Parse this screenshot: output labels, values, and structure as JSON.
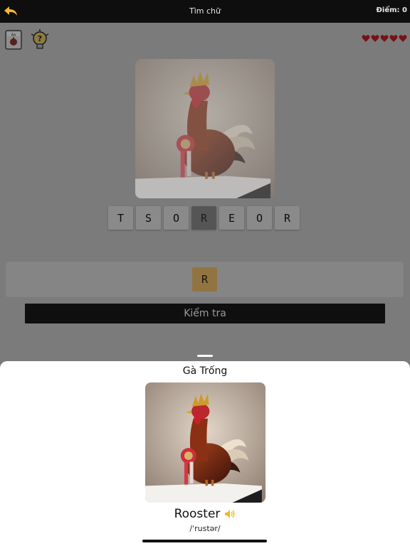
{
  "header": {
    "title": "Tìm chữ",
    "score_label": "Điểm: 0",
    "back_icon": "back-arrow-icon"
  },
  "toolbar": {
    "book_icon": "flashcard-book-icon",
    "book_badge": "Aa",
    "hint_icon": "hint-lightbulb-icon"
  },
  "lives": {
    "count": 5,
    "icon": "heart-icon",
    "color": "#e0202a"
  },
  "puzzle": {
    "image": "rooster-photo",
    "tiles": [
      {
        "letter": "T",
        "used": false
      },
      {
        "letter": "S",
        "used": false
      },
      {
        "letter": "O",
        "used": false
      },
      {
        "letter": "R",
        "used": true
      },
      {
        "letter": "E",
        "used": false
      },
      {
        "letter": "O",
        "used": false
      },
      {
        "letter": "R",
        "used": false
      }
    ],
    "answer": [
      "R"
    ],
    "check_label": "Kiểm tra"
  },
  "result_sheet": {
    "title": "Gà Trống",
    "image": "rooster-photo",
    "word": "Rooster",
    "speaker_icon": "speaker-icon",
    "pronunciation": "/ˈrustər/"
  },
  "colors": {
    "top_bar": "#0e0e0e",
    "answer_tile": "#927441",
    "check_button": "#0f0f0f",
    "speaker": "#f3b81b"
  }
}
